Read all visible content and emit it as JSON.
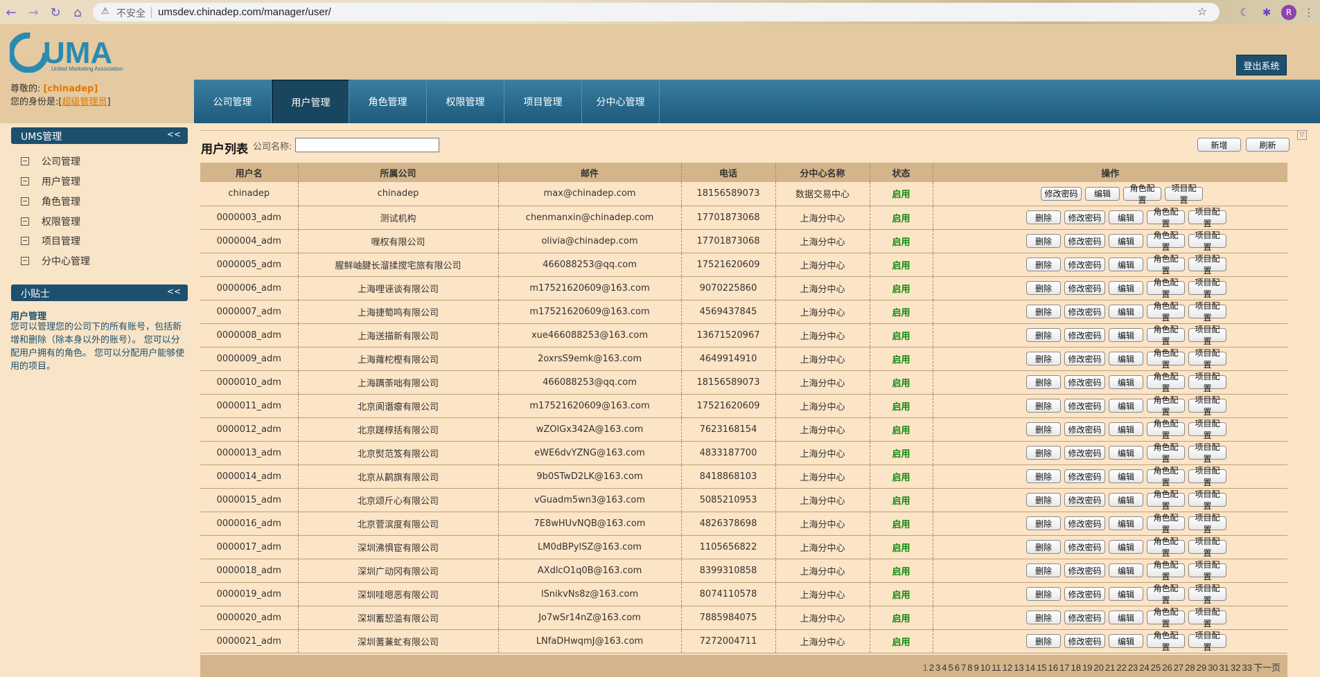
{
  "browser": {
    "insecure_label": "不安全",
    "url": "umsdev.chinadep.com/manager/user/",
    "avatar_letter": "R"
  },
  "header": {
    "logo_text": "UMA",
    "logo_sub": "United Marketing Association",
    "logout_label": "登出系统"
  },
  "userinfo": {
    "greeting": "尊敬的:",
    "username": "[chinadep]",
    "role_label": "您的身份是:",
    "role_open": "[",
    "role": "超级管理员",
    "role_close": "]"
  },
  "tabs": [
    "公司管理",
    "用户管理",
    "角色管理",
    "权限管理",
    "项目管理",
    "分中心管理"
  ],
  "sidebar": {
    "section1": "UMS管理",
    "collapse": "<<",
    "items": [
      "公司管理",
      "用户管理",
      "角色管理",
      "权限管理",
      "项目管理",
      "分中心管理"
    ],
    "section2": "小贴士",
    "tip_title": "用户管理",
    "tip_body": "您可以管理您的公司下的所有账号，包括新增和删除（除本身以外的账号）。 您可以分配用户拥有的角色。 您可以分配用户能够使用的项目。"
  },
  "content": {
    "list_title": "用户列表",
    "company_label": "公司名称:",
    "add_label": "新增",
    "refresh_label": "刷新"
  },
  "table": {
    "columns": [
      "用户名",
      "所属公司",
      "邮件",
      "电话",
      "分中心名称",
      "状态",
      "操作"
    ],
    "ops": {
      "delete": "删除",
      "password": "修改密码",
      "edit": "编辑",
      "role": "角色配置",
      "project": "项目配置"
    },
    "rows": [
      [
        "chinadep",
        "chinadep",
        "max@chinadep.com",
        "18156589073",
        "数据交易中心",
        "启用"
      ],
      [
        "0000003_adm",
        "测试机构",
        "chenmanxin@chinadep.com",
        "17701873068",
        "上海分中心",
        "启用"
      ],
      [
        "0000004_adm",
        "喱权有限公司",
        "olivia@chinadep.com",
        "17701873068",
        "上海分中心",
        "启用"
      ],
      [
        "0000005_adm",
        "腥鲜岫腱长溜揉搅宅旅有限公司",
        "466088253@qq.com",
        "17521620609",
        "上海分中心",
        "启用"
      ],
      [
        "0000006_adm",
        "上海哩诬谈有限公司",
        "m17521620609@163.com",
        "9070225860",
        "上海分中心",
        "启用"
      ],
      [
        "0000007_adm",
        "上海捷萄鸣有限公司",
        "m17521620609@163.com",
        "4569437845",
        "上海分中心",
        "启用"
      ],
      [
        "0000008_adm",
        "上海送描新有限公司",
        "xue466088253@163.com",
        "13671520967",
        "上海分中心",
        "启用"
      ],
      [
        "0000009_adm",
        "上海蕹柁樫有限公司",
        "2oxrsS9emk@163.com",
        "4649914910",
        "上海分中心",
        "启用"
      ],
      [
        "0000010_adm",
        "上海蹒荼咄有限公司",
        "466088253@qq.com",
        "18156589073",
        "上海分中心",
        "启用"
      ],
      [
        "0000011_adm",
        "北京阆谮瘪有限公司",
        "m17521620609@163.com",
        "17521620609",
        "上海分中心",
        "启用"
      ],
      [
        "0000012_adm",
        "北京蹉椁括有限公司",
        "wZOlGx342A@163.com",
        "7623168154",
        "上海分中心",
        "启用"
      ],
      [
        "0000013_adm",
        "北京熨范笈有限公司",
        "eWE6dvYZNG@163.com",
        "4833187700",
        "上海分中心",
        "启用"
      ],
      [
        "0000014_adm",
        "北京从鹋旗有限公司",
        "9b0STwD2LK@163.com",
        "8418868103",
        "上海分中心",
        "启用"
      ],
      [
        "0000015_adm",
        "北京颂斤心有限公司",
        "vGuadm5wn3@163.com",
        "5085210953",
        "上海分中心",
        "启用"
      ],
      [
        "0000016_adm",
        "北京菅滨度有限公司",
        "7E8wHUvNQB@163.com",
        "4826378698",
        "上海分中心",
        "启用"
      ],
      [
        "0000017_adm",
        "深圳沸惧宦有限公司",
        "LM0dBPylSZ@163.com",
        "1105656822",
        "上海分中心",
        "启用"
      ],
      [
        "0000018_adm",
        "深圳广动冈有限公司",
        "AXdlcO1q0B@163.com",
        "8399310858",
        "上海分中心",
        "启用"
      ],
      [
        "0000019_adm",
        "深圳哇嗯恶有限公司",
        "lSnikvNs8z@163.com",
        "8074110578",
        "上海分中心",
        "启用"
      ],
      [
        "0000020_adm",
        "深圳蓄恝滥有限公司",
        "Jo7wSr14nZ@163.com",
        "7885984075",
        "上海分中心",
        "启用"
      ],
      [
        "0000021_adm",
        "深圳蓍蒹虻有限公司",
        "LNfaDHwqmJ@163.com",
        "7272004711",
        "上海分中心",
        "启用"
      ]
    ]
  },
  "pager": {
    "pages": [
      "1",
      "2",
      "3",
      "4",
      "5",
      "6",
      "7",
      "8",
      "9",
      "10",
      "11",
      "12",
      "13",
      "14",
      "15",
      "16",
      "17",
      "18",
      "19",
      "20",
      "21",
      "22",
      "23",
      "24",
      "25",
      "26",
      "27",
      "28",
      "29",
      "30",
      "31",
      "32",
      "33"
    ],
    "next_label": "下一页"
  }
}
